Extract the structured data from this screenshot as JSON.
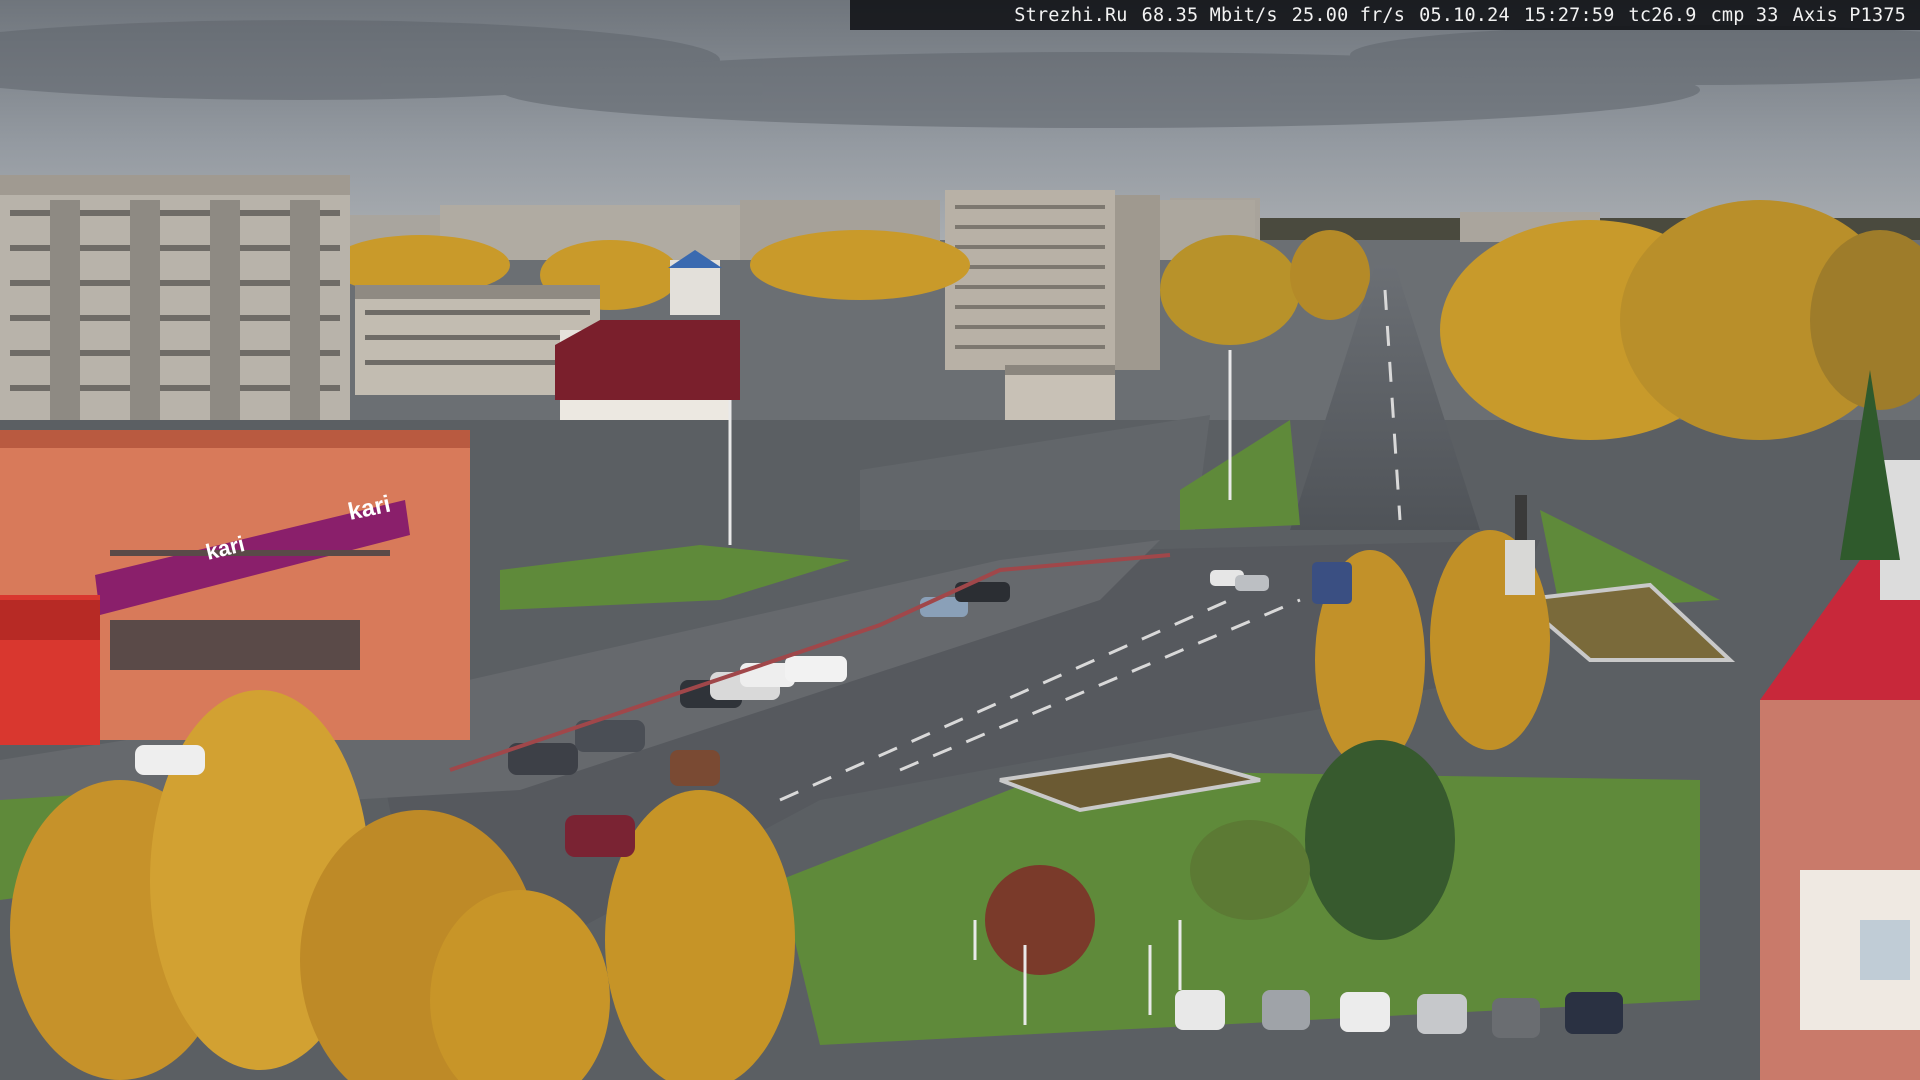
{
  "overlay": {
    "site": "Strezhi.Ru",
    "bitrate": "68.35 Mbit/s",
    "framerate": "25.00 fr/s",
    "date": "05.10.24",
    "time": "15:27:59",
    "temperature": "tc26.9",
    "compression": "cmp 33",
    "camera_model": "Axis P1375"
  },
  "signs": {
    "store_kari_small": "kari",
    "store_kari_large": "kari"
  },
  "colors": {
    "sky": "#8f959c",
    "autumn_foliage": "#c99a2a",
    "asphalt": "#5d6166",
    "grass": "#5f8a3a",
    "building_panel": "#b8b3aa",
    "shop_red": "#d24b3a",
    "kari_purple": "#8a1f6b",
    "roof_red": "#c8283a"
  }
}
